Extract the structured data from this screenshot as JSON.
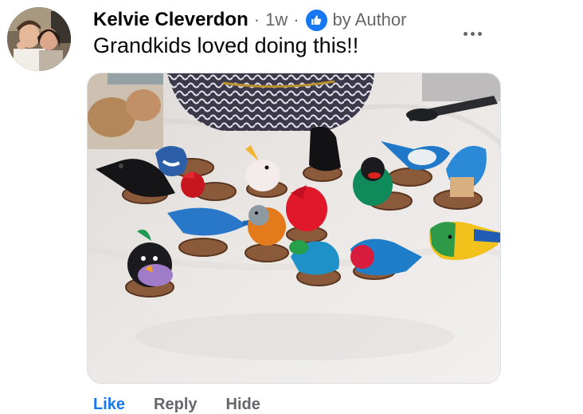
{
  "comment": {
    "author": "Kelvie Cleverdon",
    "separator": "·",
    "time": "1w",
    "badge": "by Author",
    "text": "Grandkids loved doing this!!"
  },
  "menu": {
    "icon": "more-horizontal-icon"
  },
  "actions": {
    "like": "Like",
    "reply": "Reply",
    "hide": "Hide"
  },
  "colors": {
    "accent": "#1877f2",
    "secondary_text": "#65676b",
    "primary_text": "#050505"
  }
}
